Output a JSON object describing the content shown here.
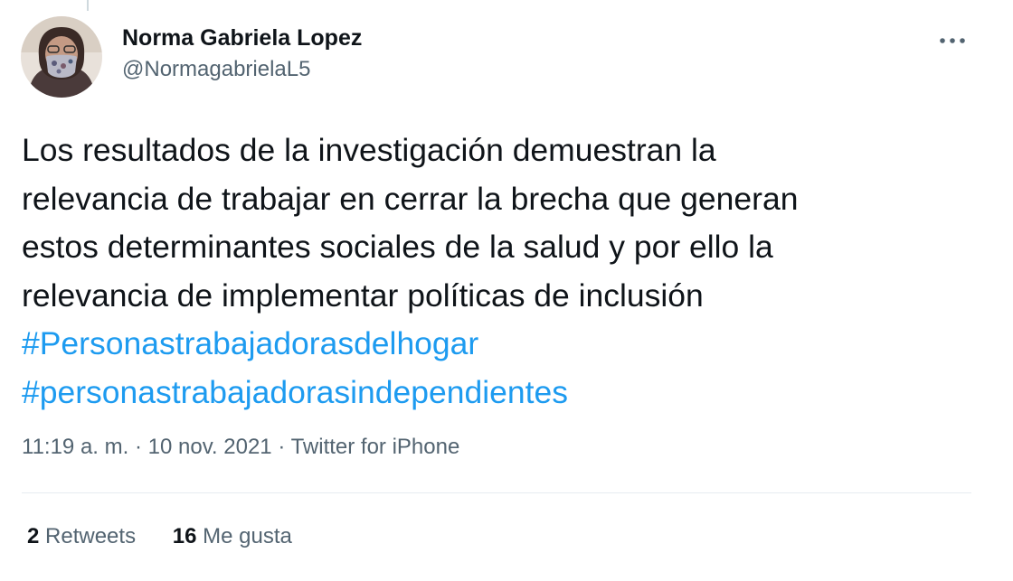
{
  "tweet": {
    "author": {
      "display_name": "Norma Gabriela Lopez",
      "handle": "@NormagabrielaL5"
    },
    "text_lines": [
      "Los resultados de la investigación demuestran la",
      "relevancia de trabajar en cerrar la brecha que generan",
      "estos determinantes sociales de la salud y por ello la",
      "relevancia de implementar políticas de inclusión"
    ],
    "hashtags": [
      "#Personastrabajadorasdelhogar",
      "#personastrabajadorasindependientes"
    ],
    "time": "11:19 a. m.",
    "date": "10 nov. 2021",
    "source": "Twitter for iPhone",
    "separator": "·",
    "stats": {
      "retweets_count": "2",
      "retweets_label": "Retweets",
      "likes_count": "16",
      "likes_label": "Me gusta"
    }
  },
  "icons": {
    "more": "more-icon"
  },
  "colors": {
    "link": "#1d9bf0",
    "text": "#0f1419",
    "secondary": "#536471"
  }
}
